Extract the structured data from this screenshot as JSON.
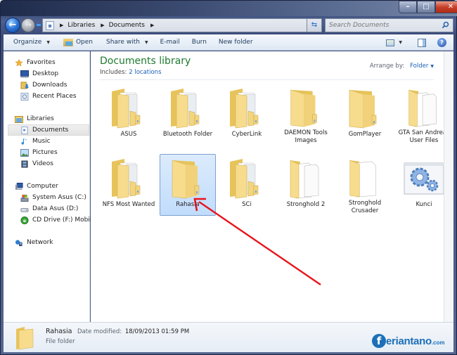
{
  "window": {
    "controls": {
      "minimize": "–",
      "maximize": "□",
      "close": "✕"
    }
  },
  "nav": {
    "back_icon": "back-arrow-icon",
    "forward_icon": "forward-arrow-icon",
    "breadcrumb": [
      "Libraries",
      "Documents"
    ],
    "search_placeholder": "Search Documents"
  },
  "toolbar": {
    "organize": "Organize",
    "open": "Open",
    "share_with": "Share with",
    "email": "E-mail",
    "burn": "Burn",
    "new_folder": "New folder",
    "help": "?"
  },
  "sidebar": {
    "favorites": {
      "label": "Favorites",
      "items": [
        "Desktop",
        "Downloads",
        "Recent Places"
      ]
    },
    "libraries": {
      "label": "Libraries",
      "items": [
        "Documents",
        "Music",
        "Pictures",
        "Videos"
      ],
      "selected": "Documents"
    },
    "computer": {
      "label": "Computer",
      "items": [
        "System Asus (C:)",
        "Data Asus (D:)",
        "CD Drive (F:) Mobile"
      ]
    },
    "network": {
      "label": "Network"
    }
  },
  "library": {
    "title": "Documents library",
    "includes_label": "Includes:",
    "includes_link": "2 locations",
    "arrange_label": "Arrange by:",
    "arrange_value": "Folder"
  },
  "items": [
    {
      "name": "ASUS",
      "type": "folder-docs"
    },
    {
      "name": "Bluetooth Folder",
      "type": "folder-docs"
    },
    {
      "name": "CyberLink",
      "type": "folder-docs"
    },
    {
      "name": "DAEMON Tools Images",
      "type": "folder-empty"
    },
    {
      "name": "GomPlayer",
      "type": "folder-empty"
    },
    {
      "name": "GTA San Andreas User Files",
      "type": "folder-files"
    },
    {
      "name": "NFS Most Wanted",
      "type": "folder-docs"
    },
    {
      "name": "Rahasia",
      "type": "folder-empty",
      "selected": true
    },
    {
      "name": "SCi",
      "type": "folder-docs"
    },
    {
      "name": "Stronghold 2",
      "type": "folder-files"
    },
    {
      "name": "Stronghold Crusader",
      "type": "folder-file"
    },
    {
      "name": "Kunci",
      "type": "settings-file"
    }
  ],
  "details": {
    "name": "Rahasia",
    "date_label": "Date modified:",
    "date_value": "18/09/2013 01:59 PM",
    "type": "File folder"
  },
  "watermark": {
    "letter": "f",
    "text": "eriantano",
    "suffix": ".com"
  },
  "annotation": {
    "color": "#e8141b",
    "target": "Rahasia"
  }
}
